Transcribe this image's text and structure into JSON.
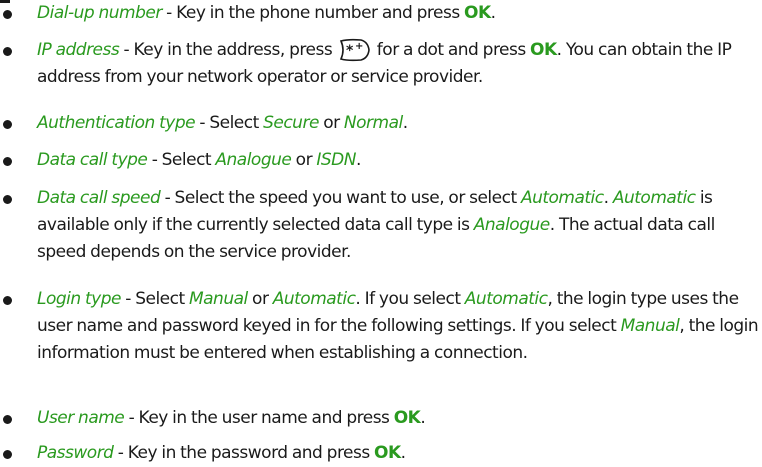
{
  "items": [
    {
      "term": "Dial-up number",
      "sep": " - ",
      "text1": "Key in the phone number and press ",
      "key1": "OK",
      "end": "."
    },
    {
      "term": "IP address",
      "sep": " - ",
      "text1": "Key in the address, press ",
      "icon": "star-plus-key-icon",
      "text2": " for a dot and press ",
      "key1": "OK",
      "text3": ". You can obtain the IP address from your network operator or service provider."
    },
    {
      "term": "Authentication type",
      "sep": " - ",
      "text1": "Select ",
      "opt1": "Secure",
      "or": " or ",
      "opt2": "Normal",
      "end": "."
    },
    {
      "term": "Data call type",
      "sep": " - ",
      "text1": "Select ",
      "opt1": "Analogue",
      "or": " or ",
      "opt2": "ISDN",
      "end": "."
    },
    {
      "term": "Data call speed",
      "sep": " - ",
      "text1": "Select the speed you want to use, or select ",
      "opt1": "Automatic",
      "text2": ". ",
      "opt2": "Automatic",
      "text3": " is available only if the currently selected data call type is ",
      "opt3": "Analogue",
      "text4": ". The actual data call speed depends on the service provider."
    },
    {
      "term": "Login type",
      "sep": " - ",
      "text1": "Select ",
      "opt1": "Manual",
      "or": " or ",
      "opt2": "Automatic",
      "text2": ". If you select ",
      "opt3": "Automatic",
      "text3": ", the login type uses the user name and password keyed in for the following settings. If you select ",
      "opt4": "Manual",
      "text4": ", the login information must be entered when establishing a connection."
    },
    {
      "term": "User name",
      "sep": " - ",
      "text1": "Key in the user name and press ",
      "key1": "OK",
      "end": "."
    },
    {
      "term": "Password",
      "sep": " - ",
      "text1": "Key in the password and press ",
      "key1": "OK",
      "end": "."
    }
  ],
  "colors": {
    "accent": "#2a9a1f",
    "text": "#1a1a1a"
  }
}
